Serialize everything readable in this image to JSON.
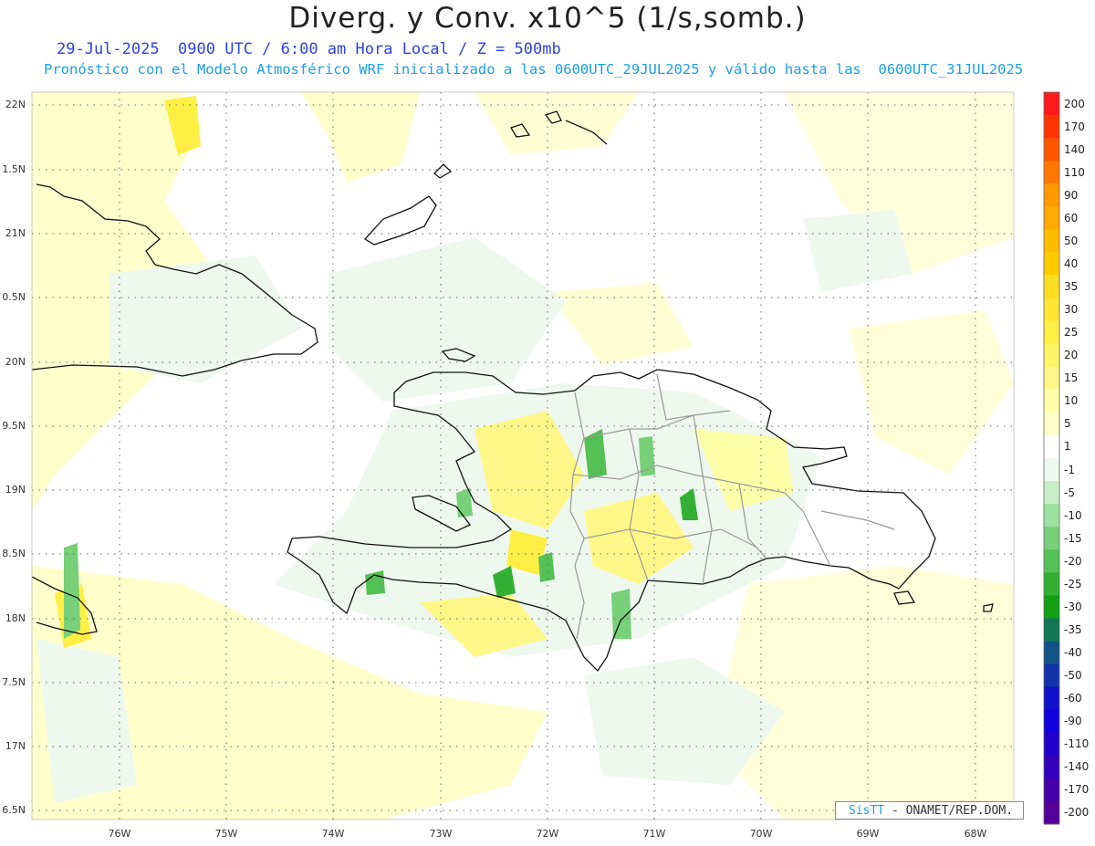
{
  "header": {
    "title": "Diverg. y Conv. x10^5 (1/s,somb.)",
    "subtitle": "29-Jul-2025  0900 UTC / 6:00 am Hora Local / Z = 500mb",
    "description": "Pronóstico con el Modelo Atmosférico WRF inicializado a las 0600UTC_29JUL2025 y válido hasta las  0600UTC_31JUL2025"
  },
  "axes": {
    "lat_labels": [
      "22N",
      "1.5N",
      "21N",
      "0.5N",
      "20N",
      "9.5N",
      "19N",
      "8.5N",
      "18N",
      "7.5N",
      "17N",
      "6.5N"
    ],
    "lon_labels": [
      "76W",
      "75W",
      "74W",
      "73W",
      "72W",
      "71W",
      "70W",
      "69W",
      "68W"
    ]
  },
  "colorbar": {
    "labels": [
      "200",
      "170",
      "140",
      "110",
      "90",
      "60",
      "50",
      "40",
      "35",
      "30",
      "25",
      "20",
      "15",
      "10",
      "5",
      "1",
      "-1",
      "-5",
      "-10",
      "-15",
      "-20",
      "-25",
      "-30",
      "-35",
      "-40",
      "-50",
      "-60",
      "-90",
      "-110",
      "-140",
      "-170",
      "-200"
    ],
    "colors": [
      "#ff1a1a",
      "#ff3300",
      "#ff5500",
      "#ff7700",
      "#ff9900",
      "#ffaa00",
      "#ffbb00",
      "#ffcc00",
      "#ffdd22",
      "#ffe633",
      "#ffee44",
      "#fff566",
      "#fff888",
      "#ffffaa",
      "#ffffcc",
      "#ffffff",
      "#eef8ee",
      "#c8eec8",
      "#9ee09e",
      "#78d078",
      "#55c055",
      "#33b033",
      "#12a012",
      "#117755",
      "#115588",
      "#1133aa",
      "#1111cc",
      "#1100dd",
      "#2200cc",
      "#3300bb",
      "#4400aa",
      "#550099"
    ]
  },
  "credit": {
    "brand": "SisTT",
    "text": " - ONAMET/REP.DOM."
  }
}
